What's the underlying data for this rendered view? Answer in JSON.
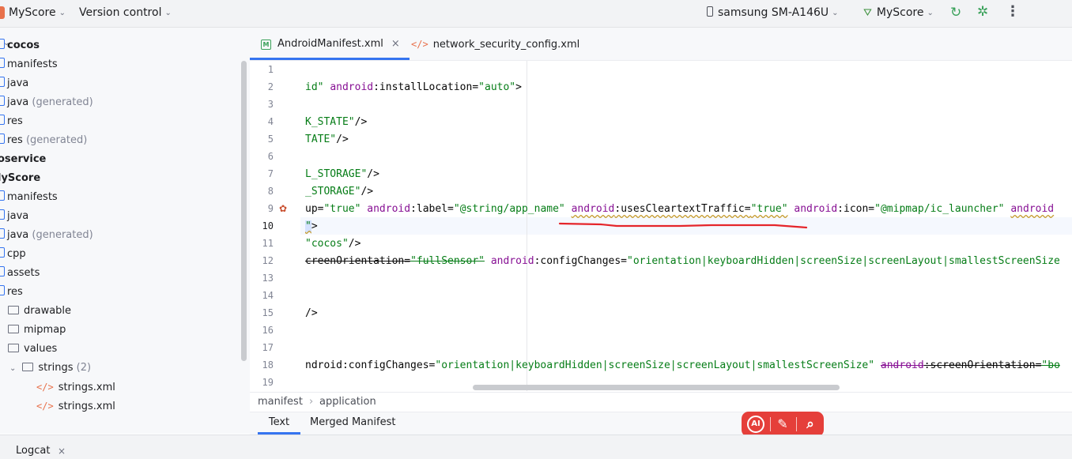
{
  "titlebar": {
    "project": "MyScore",
    "vcs": "Version control",
    "device": "samsung SM-A146U",
    "run_config": "MyScore"
  },
  "tree": [
    {
      "label": "cocos",
      "suffix": "",
      "indent": 0,
      "icon": "module",
      "bold": true
    },
    {
      "label": "manifests",
      "suffix": "",
      "indent": 0,
      "icon": "module"
    },
    {
      "label": "java",
      "suffix": "",
      "indent": 0,
      "icon": "module"
    },
    {
      "label": "java",
      "suffix": " (generated)",
      "indent": 0,
      "icon": "module"
    },
    {
      "label": "res",
      "suffix": "",
      "indent": 0,
      "icon": "module"
    },
    {
      "label": "res",
      "suffix": " (generated)",
      "indent": 0,
      "icon": "module"
    },
    {
      "label": "oservice",
      "suffix": "",
      "indent": 0,
      "icon": "none",
      "bold": true
    },
    {
      "label": "lyScore",
      "suffix": "",
      "indent": 0,
      "icon": "none",
      "bold": true
    },
    {
      "label": "manifests",
      "suffix": "",
      "indent": 0,
      "icon": "module"
    },
    {
      "label": "java",
      "suffix": "",
      "indent": 0,
      "icon": "module"
    },
    {
      "label": "java",
      "suffix": " (generated)",
      "indent": 0,
      "icon": "module"
    },
    {
      "label": "cpp",
      "suffix": "",
      "indent": 0,
      "icon": "module"
    },
    {
      "label": "assets",
      "suffix": "",
      "indent": 0,
      "icon": "module"
    },
    {
      "label": "res",
      "suffix": "",
      "indent": 0,
      "icon": "module"
    },
    {
      "label": "drawable",
      "suffix": "",
      "indent": 1,
      "icon": "folder"
    },
    {
      "label": "mipmap",
      "suffix": "",
      "indent": 1,
      "icon": "folder"
    },
    {
      "label": "values",
      "suffix": "",
      "indent": 1,
      "icon": "folder"
    },
    {
      "label": "strings",
      "suffix": " (2)",
      "indent": 1,
      "icon": "folder-open"
    },
    {
      "label": "strings.xml",
      "suffix": "",
      "indent": 2,
      "icon": "xml"
    },
    {
      "label": "strings.xml",
      "suffix": "",
      "indent": 2,
      "icon": "xml"
    }
  ],
  "tabs": [
    {
      "label": "AndroidManifest.xml",
      "active": true
    },
    {
      "label": "network_security_config.xml",
      "active": false
    }
  ],
  "lines": [
    {
      "n": "1",
      "segs": []
    },
    {
      "n": "2",
      "segs": [
        {
          "t": "val",
          "x": "id\""
        },
        {
          "t": "plain",
          "x": " "
        },
        {
          "t": "attr",
          "x": "android"
        },
        {
          "t": "plain",
          "x": ":installLocation="
        },
        {
          "t": "val",
          "x": "\"auto\""
        },
        {
          "t": "plain",
          "x": ">"
        }
      ]
    },
    {
      "n": "3",
      "segs": []
    },
    {
      "n": "4",
      "segs": [
        {
          "t": "val",
          "x": "K_STATE\""
        },
        {
          "t": "plain",
          "x": "/>"
        }
      ]
    },
    {
      "n": "5",
      "segs": [
        {
          "t": "val",
          "x": "TATE\""
        },
        {
          "t": "plain",
          "x": "/>"
        }
      ]
    },
    {
      "n": "6",
      "segs": []
    },
    {
      "n": "7",
      "segs": [
        {
          "t": "val",
          "x": "L_STORAGE\""
        },
        {
          "t": "plain",
          "x": "/>"
        }
      ]
    },
    {
      "n": "8",
      "segs": [
        {
          "t": "val",
          "x": "_STORAGE\""
        },
        {
          "t": "plain",
          "x": "/>"
        }
      ]
    },
    {
      "n": "9",
      "segs": [
        {
          "t": "plain",
          "x": "up="
        },
        {
          "t": "val",
          "x": "\"true\""
        },
        {
          "t": "plain",
          "x": " "
        },
        {
          "t": "attr",
          "x": "android"
        },
        {
          "t": "plain",
          "x": ":label="
        },
        {
          "t": "val",
          "x": "\"@string/app_name\""
        },
        {
          "t": "plain",
          "x": " "
        },
        {
          "t": "attr-warn",
          "x": "android"
        },
        {
          "t": "plain-warn",
          "x": ":usesCleartextTraffic="
        },
        {
          "t": "val-warn",
          "x": "\"true\""
        },
        {
          "t": "plain",
          "x": " "
        },
        {
          "t": "attr",
          "x": "android"
        },
        {
          "t": "plain",
          "x": ":icon="
        },
        {
          "t": "val",
          "x": "\"@mipmap/ic_launcher\""
        },
        {
          "t": "plain",
          "x": " "
        },
        {
          "t": "attr-warn",
          "x": "android"
        }
      ]
    },
    {
      "n": "10",
      "segs": [
        {
          "t": "cursor",
          "x": "\""
        },
        {
          "t": "plain",
          "x": ">"
        }
      ]
    },
    {
      "n": "11",
      "segs": [
        {
          "t": "val",
          "x": "\"cocos\""
        },
        {
          "t": "plain",
          "x": "/>"
        }
      ]
    },
    {
      "n": "12",
      "segs": [
        {
          "t": "plain-strike",
          "x": "creenOrientation="
        },
        {
          "t": "val-strike",
          "x": "\"fullSensor\""
        },
        {
          "t": "plain",
          "x": " "
        },
        {
          "t": "attr",
          "x": "android"
        },
        {
          "t": "plain",
          "x": ":configChanges="
        },
        {
          "t": "val",
          "x": "\"orientation|keyboardHidden|screenSize|screenLayout|smallestScreenSize"
        }
      ]
    },
    {
      "n": "13",
      "segs": []
    },
    {
      "n": "14",
      "segs": []
    },
    {
      "n": "15",
      "segs": [
        {
          "t": "plain",
          "x": "/>"
        }
      ]
    },
    {
      "n": "16",
      "segs": []
    },
    {
      "n": "17",
      "segs": []
    },
    {
      "n": "18",
      "segs": [
        {
          "t": "plain",
          "x": "ndroid:configChanges="
        },
        {
          "t": "val",
          "x": "\"orientation|keyboardHidden|screenSize|screenLayout|smallestScreenSize\""
        },
        {
          "t": "plain",
          "x": " "
        },
        {
          "t": "attr-strike",
          "x": "android"
        },
        {
          "t": "plain-strike",
          "x": ":screenOrientation="
        },
        {
          "t": "val-strike",
          "x": "\"bo"
        }
      ]
    },
    {
      "n": "19",
      "segs": []
    }
  ],
  "breadcrumb": [
    "manifest",
    "application"
  ],
  "breadcrumb_sep": "›",
  "manifest_tabs": [
    "Text",
    "Merged Manifest"
  ],
  "ai_toolbar": {
    "ai_label": "AI"
  },
  "bottom": {
    "logcat": "Logcat"
  }
}
